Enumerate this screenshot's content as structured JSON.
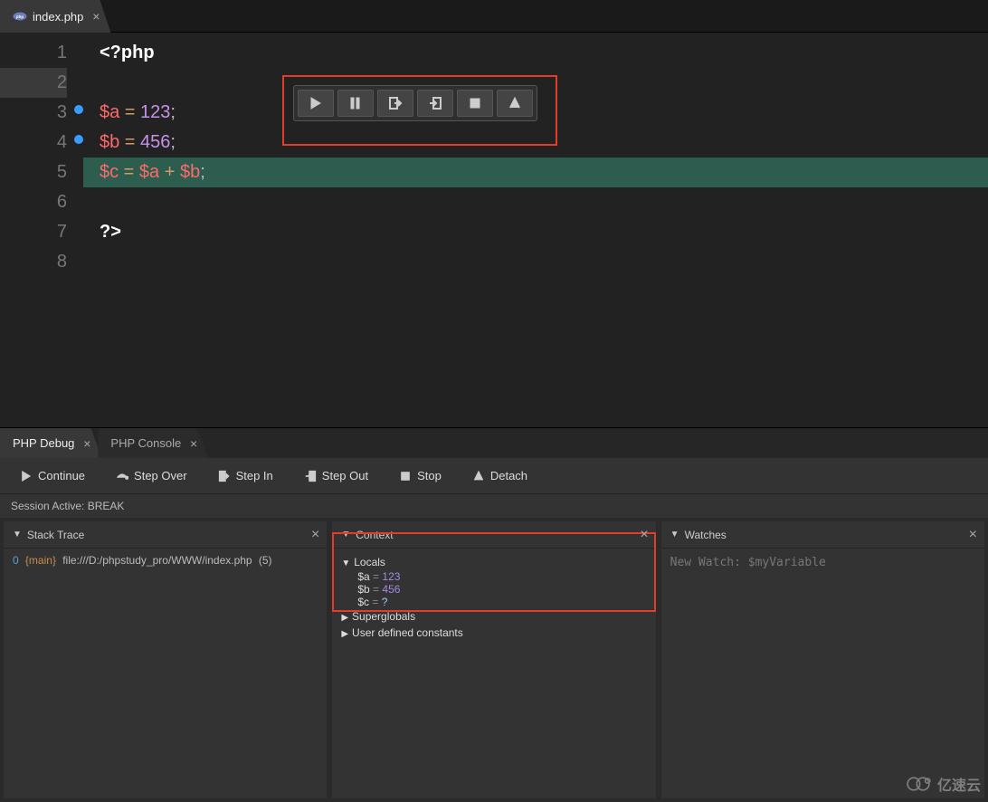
{
  "editor": {
    "tab": {
      "title": "index.php"
    },
    "lines": {
      "l1": "1",
      "l2": "2",
      "l3": "3",
      "l4": "4",
      "l5": "5",
      "l6": "6",
      "l7": "7",
      "l8": "8"
    },
    "code": {
      "open": "<?php",
      "a_var": "$a",
      "a_eq": " = ",
      "a_val": "123",
      "a_semi": ";",
      "b_var": "$b",
      "b_eq": " = ",
      "b_val": "456",
      "b_semi": ";",
      "c_var": "$c",
      "c_eq": " = ",
      "c_a": "$a",
      "c_plus": " + ",
      "c_b": "$b",
      "c_semi": ";",
      "close": "?>"
    }
  },
  "bottom_tabs": {
    "debug": "PHP Debug",
    "console": "PHP Console"
  },
  "dbg_buttons": {
    "continue": "Continue",
    "stepover": "Step Over",
    "stepin": "Step In",
    "stepout": "Step Out",
    "stop": "Stop",
    "detach": "Detach"
  },
  "status": "Session Active: BREAK",
  "panels": {
    "stack": {
      "title": "Stack Trace",
      "row": {
        "idx": "0",
        "main": "{main}",
        "path": "file:///D:/phpstudy_pro/WWW/index.php",
        "ln": "(5)"
      }
    },
    "context": {
      "title": "Context",
      "locals_label": "Locals",
      "vars": {
        "a": {
          "name": "$a",
          "val": "123"
        },
        "b": {
          "name": "$b",
          "val": "456"
        },
        "c": {
          "name": "$c",
          "val": "?"
        }
      },
      "superglobals": "Superglobals",
      "userconst": "User defined constants"
    },
    "watches": {
      "title": "Watches",
      "placeholder": "New Watch: $myVariable"
    }
  },
  "watermark": "亿速云"
}
